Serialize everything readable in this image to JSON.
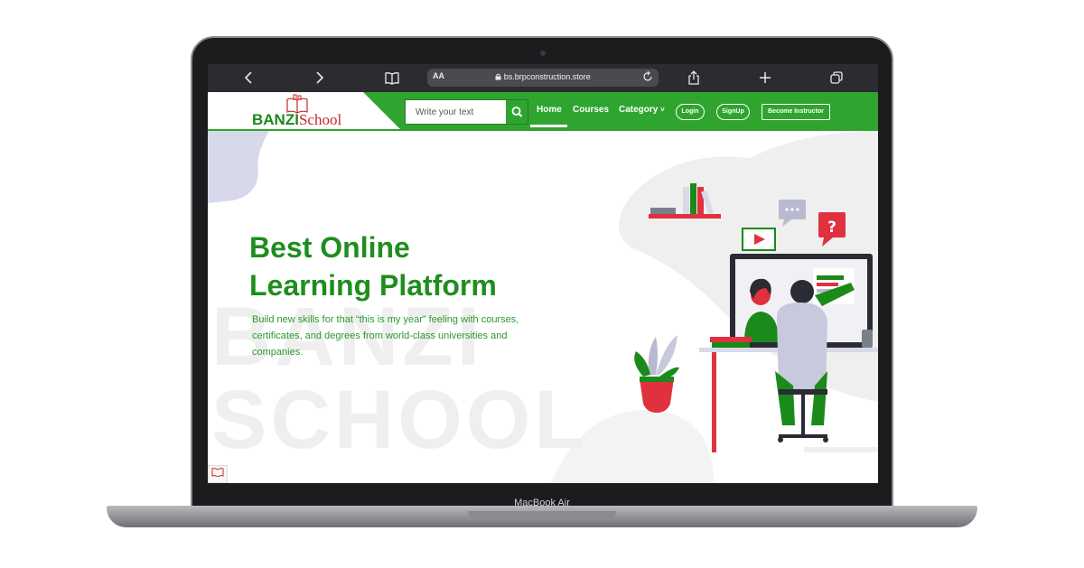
{
  "device": {
    "model_label": "MacBook Air"
  },
  "browser": {
    "back_icon": "chevron-left-icon",
    "forward_icon": "chevron-right-icon",
    "reader_icon": "book-icon",
    "text_size_label": "AA",
    "url": "bs.brpconstruction.store",
    "lock_icon": "lock-icon",
    "reload_icon": "reload-icon",
    "share_icon": "share-icon",
    "new_tab_icon": "plus-icon",
    "tabs_icon": "tabs-icon"
  },
  "header": {
    "logo": {
      "part1": "BANZI",
      "part2": "School"
    },
    "search": {
      "placeholder": "Write your text",
      "icon": "search-icon"
    },
    "nav": {
      "home": "Home",
      "courses": "Courses",
      "category": "Category",
      "category_caret": "˅",
      "login": "Login",
      "signup": "SignUp",
      "become_instructor": "Become Instructor"
    },
    "colors": {
      "brand_green": "#2fa52f",
      "accent_red": "#e0313f"
    }
  },
  "hero": {
    "watermark_line1": "BANZI",
    "watermark_line2": "SCHOOL",
    "title_line1": "Best Online",
    "title_line2": "Learning Platform",
    "subtitle": "Build new skills for that “this is my year” feeling with courses, certificates, and degrees from world-class universities and companies."
  }
}
